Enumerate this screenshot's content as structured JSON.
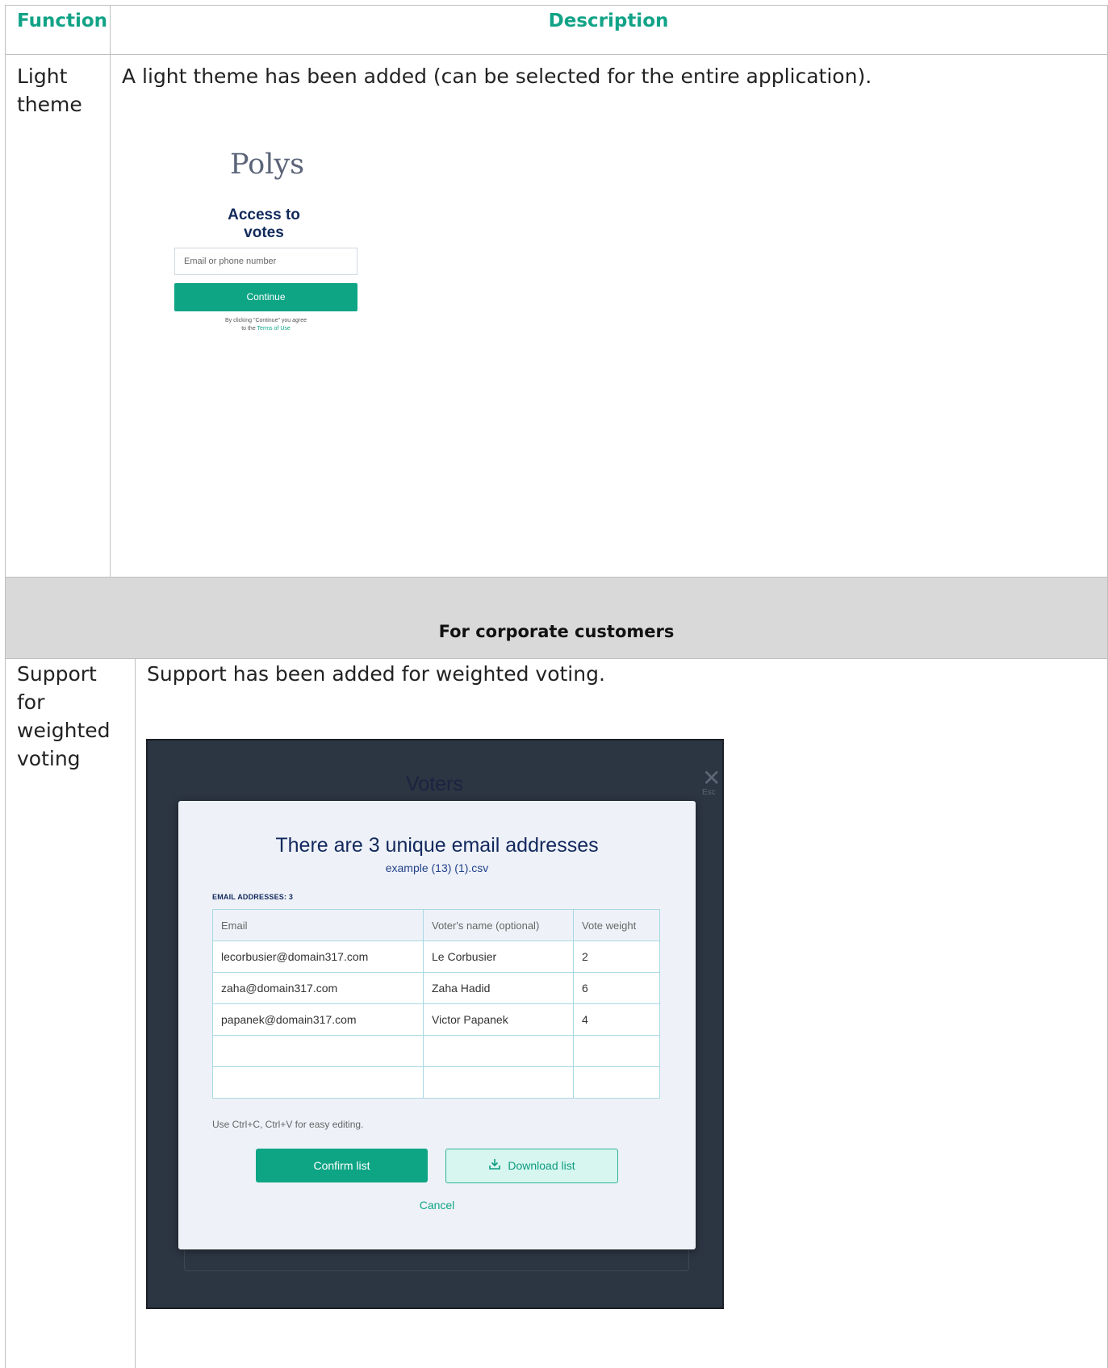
{
  "header": {
    "function_col": "Function",
    "description_col": "Description"
  },
  "row_light": {
    "function": "Light theme",
    "description": "A light theme has been added (can be selected for the entire application).",
    "mock": {
      "logo": "Polys",
      "heading": "Access to votes",
      "input_placeholder": "Email or phone number",
      "button": "Continue",
      "terms_line1": "By clicking \"Continue\" you agree",
      "terms_line2_prefix": "to the ",
      "terms_link": "Terms of Use"
    }
  },
  "section": {
    "title": "For corporate customers"
  },
  "row_weighted": {
    "function": "Support for weighted voting",
    "description": "Support has been added for weighted voting.",
    "mock": {
      "background_title": "Voters",
      "close_label": "Esc",
      "modal_title": "There are 3 unique email addresses",
      "file_name": "example (13) (1).csv",
      "count_label": "EMAIL ADDRESSES: 3",
      "columns": [
        "Email",
        "Voter's name (optional)",
        "Vote weight"
      ],
      "rows": [
        [
          "lecorbusier@domain317.com",
          "Le Corbusier",
          "2"
        ],
        [
          "zaha@domain317.com",
          "Zaha Hadid",
          "6"
        ],
        [
          "papanek@domain317.com",
          "Victor Papanek",
          "4"
        ],
        [
          "",
          "",
          ""
        ],
        [
          "",
          "",
          ""
        ]
      ],
      "hint": "Use Ctrl+C, Ctrl+V for easy editing.",
      "confirm_button": "Confirm list",
      "download_button": "Download list",
      "cancel_link": "Cancel"
    }
  },
  "colors": {
    "accent": "#12a387",
    "navy": "#13295e",
    "dark_bg": "#2c3542"
  }
}
